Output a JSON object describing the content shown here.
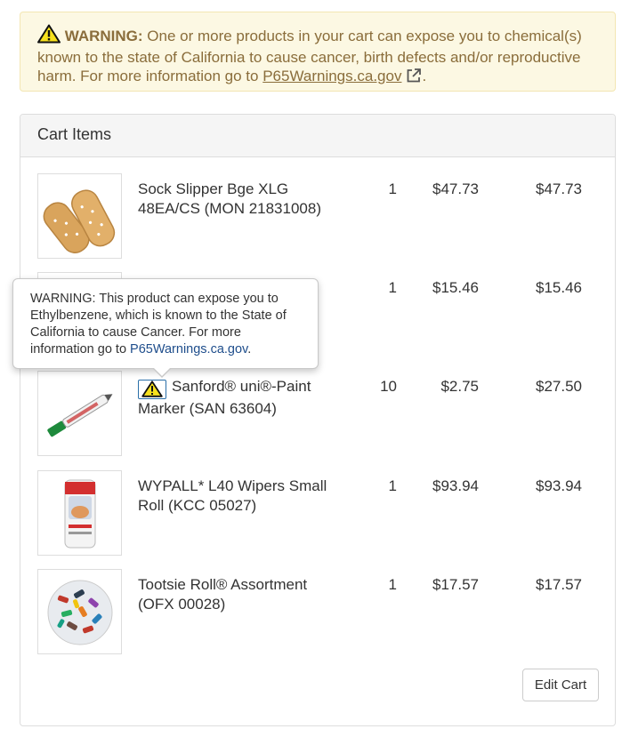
{
  "banner": {
    "icon": "warning-triangle-icon",
    "label": "WARNING:",
    "text": " One or more products in your cart can expose you to chemical(s) known to the state of California to cause cancer, birth defects and/or reproductive harm. For more information go to ",
    "link": "P65Warnings.ca.gov",
    "link_icon": "external-link-icon",
    "trailing": "."
  },
  "cart": {
    "heading": "Cart Items",
    "items": [
      {
        "description": "Sock Slipper Bge XLG 48EA/CS (MON 21831008)",
        "qty": "1",
        "price": "$47.73",
        "total": "$47.73",
        "image": "sock-slipper-image"
      },
      {
        "description": "",
        "qty": "1",
        "price": "$15.46",
        "total": "$15.46",
        "image": "product-image"
      },
      {
        "description": "Sanford® uni®-Paint Marker (SAN 63604)",
        "qty": "10",
        "price": "$2.75",
        "total": "$27.50",
        "image": "paint-marker-image",
        "warning": true
      },
      {
        "description": "WYPALL* L40 Wipers Small Roll (KCC 05027)",
        "qty": "1",
        "price": "$93.94",
        "total": "$93.94",
        "image": "wipers-roll-image"
      },
      {
        "description": "Tootsie Roll® Assortment (OFX 00028)",
        "qty": "1",
        "price": "$17.57",
        "total": "$17.57",
        "image": "tootsie-roll-image"
      }
    ],
    "edit_button": "Edit Cart"
  },
  "tooltip": {
    "text": "WARNING: This product can expose you to Ethylbenzene, which is known to the State of California to cause Cancer. For more information go to ",
    "link": "P65Warnings.ca.gov",
    "trailing": "."
  },
  "colors": {
    "banner_bg": "#fcf8e3",
    "banner_text": "#8a6d3b",
    "warning_yellow": "#f7e11d",
    "link_blue": "#1f4e8c"
  }
}
